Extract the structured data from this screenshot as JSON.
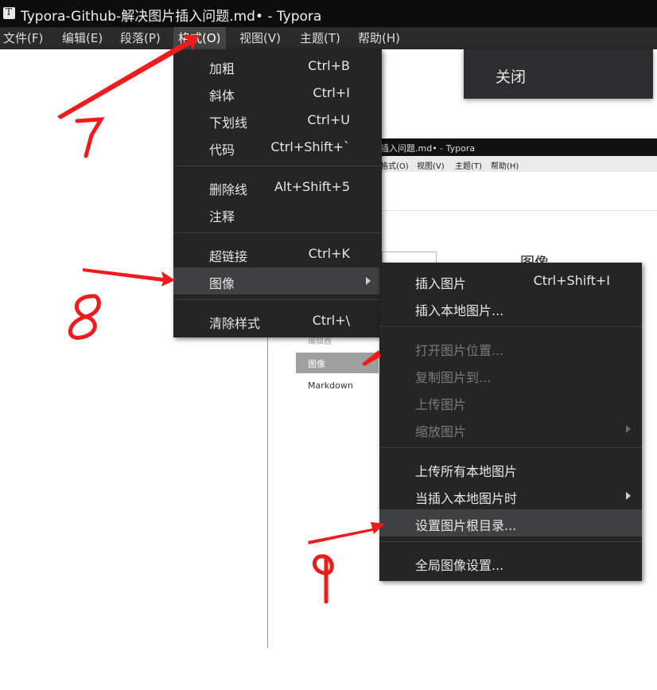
{
  "window": {
    "title": "Typora-Github-解决图片插入问题.md• - Typora"
  },
  "menubar": [
    {
      "label": "文件(F)"
    },
    {
      "label": "编辑(E)"
    },
    {
      "label": "段落(P)"
    },
    {
      "label": "格式(O)"
    },
    {
      "label": "视图(V)"
    },
    {
      "label": "主题(T)"
    },
    {
      "label": "帮助(H)"
    }
  ],
  "close_panel": {
    "label": "关闭"
  },
  "format_menu": {
    "items": [
      {
        "label": "加粗",
        "shortcut": "Ctrl+B"
      },
      {
        "label": "斜体",
        "shortcut": "Ctrl+I"
      },
      {
        "label": "下划线",
        "shortcut": "Ctrl+U"
      },
      {
        "label": "代码",
        "shortcut": "Ctrl+Shift+`"
      },
      {
        "label": "删除线",
        "shortcut": "Alt+Shift+5"
      },
      {
        "label": "注释",
        "shortcut": ""
      },
      {
        "label": "超链接",
        "shortcut": "Ctrl+K"
      },
      {
        "label": "图像",
        "shortcut": ""
      },
      {
        "label": "清除样式",
        "shortcut": "Ctrl+\\"
      }
    ]
  },
  "image_menu": {
    "items": [
      {
        "label": "插入图片",
        "shortcut": "Ctrl+Shift+I"
      },
      {
        "label": "插入本地图片...",
        "shortcut": ""
      },
      {
        "label": "打开图片位置...",
        "shortcut": ""
      },
      {
        "label": "复制图片到...",
        "shortcut": ""
      },
      {
        "label": "上传图片",
        "shortcut": ""
      },
      {
        "label": "缩放图片",
        "shortcut": ""
      },
      {
        "label": "上传所有本地图片",
        "shortcut": ""
      },
      {
        "label": "当插入本地图片时",
        "shortcut": ""
      },
      {
        "label": "设置图片根目录...",
        "shortcut": ""
      },
      {
        "label": "全局图像设置...",
        "shortcut": ""
      }
    ]
  },
  "nested": {
    "title": "插入问题.md• - Typora",
    "menu": [
      "格式(O)",
      "视图(V)",
      "主题(T)",
      "帮助(H)"
    ],
    "heading": "图像",
    "selected_item": "图像",
    "cut_item": "编辑器",
    "last_item": "Markdown"
  },
  "annotations": {
    "step7": "7",
    "step8": "8",
    "step9": "9",
    "color": "#ee1c1c"
  }
}
